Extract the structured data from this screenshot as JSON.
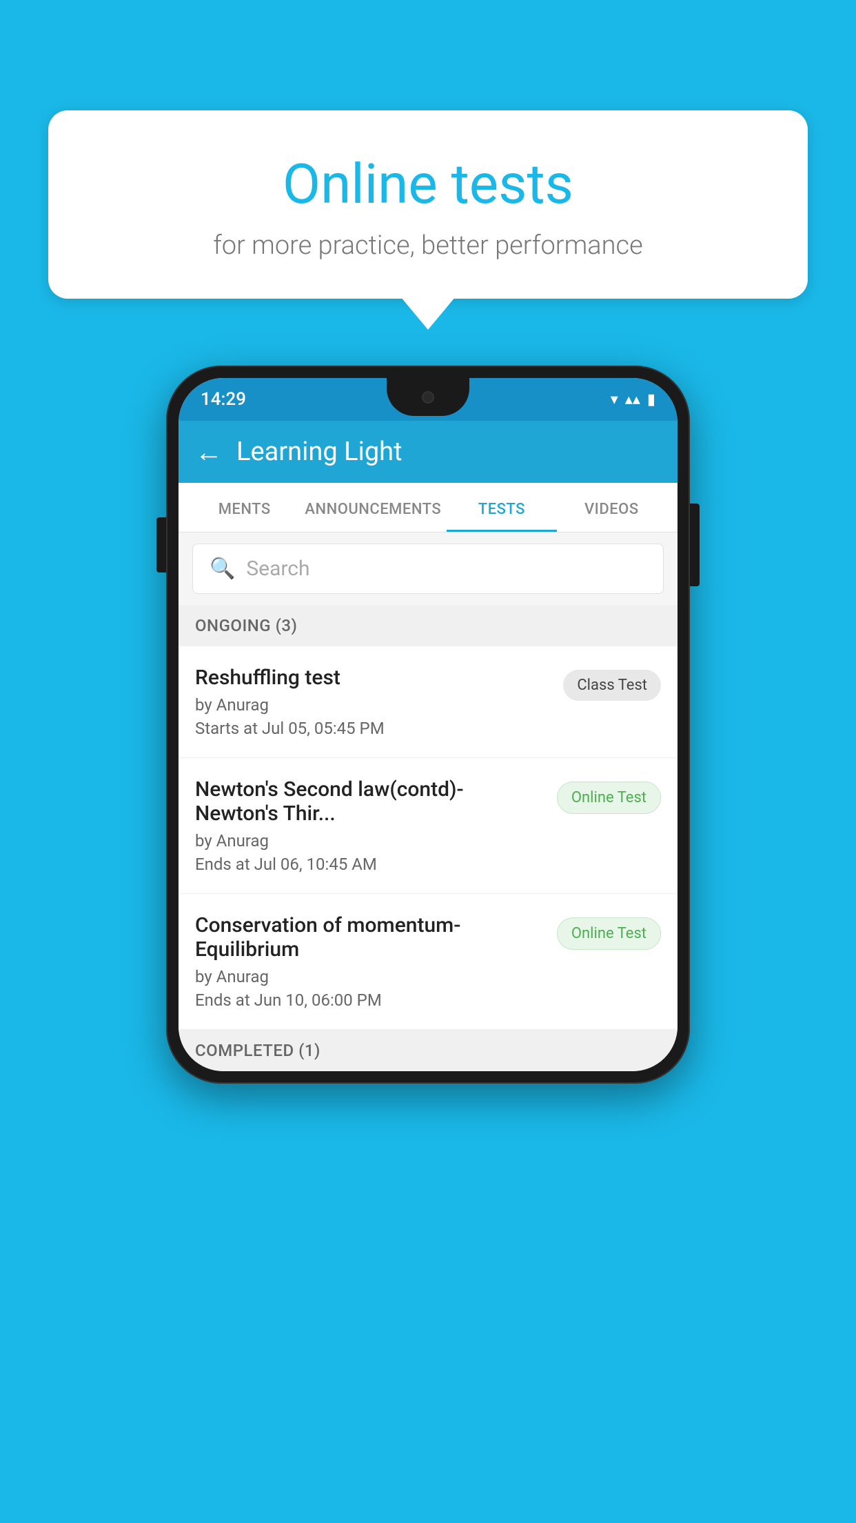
{
  "background": {
    "color": "#1ab8e8"
  },
  "speech_bubble": {
    "title": "Online tests",
    "subtitle": "for more practice, better performance"
  },
  "phone": {
    "status_bar": {
      "time": "14:29",
      "wifi": "▼",
      "signal": "▲",
      "battery": "▮"
    },
    "app_bar": {
      "back_label": "←",
      "title": "Learning Light"
    },
    "tabs": [
      {
        "label": "MENTS",
        "active": false
      },
      {
        "label": "ANNOUNCEMENTS",
        "active": false
      },
      {
        "label": "TESTS",
        "active": true
      },
      {
        "label": "VIDEOS",
        "active": false
      }
    ],
    "search": {
      "placeholder": "Search"
    },
    "section_ongoing": {
      "label": "ONGOING (3)"
    },
    "tests": [
      {
        "name": "Reshuffling test",
        "by": "by Anurag",
        "time": "Starts at  Jul 05, 05:45 PM",
        "badge": "Class Test",
        "badge_type": "class"
      },
      {
        "name": "Newton's Second law(contd)-Newton's Thir...",
        "by": "by Anurag",
        "time": "Ends at  Jul 06, 10:45 AM",
        "badge": "Online Test",
        "badge_type": "online"
      },
      {
        "name": "Conservation of momentum-Equilibrium",
        "by": "by Anurag",
        "time": "Ends at  Jun 10, 06:00 PM",
        "badge": "Online Test",
        "badge_type": "online"
      }
    ],
    "section_completed": {
      "label": "COMPLETED (1)"
    }
  }
}
